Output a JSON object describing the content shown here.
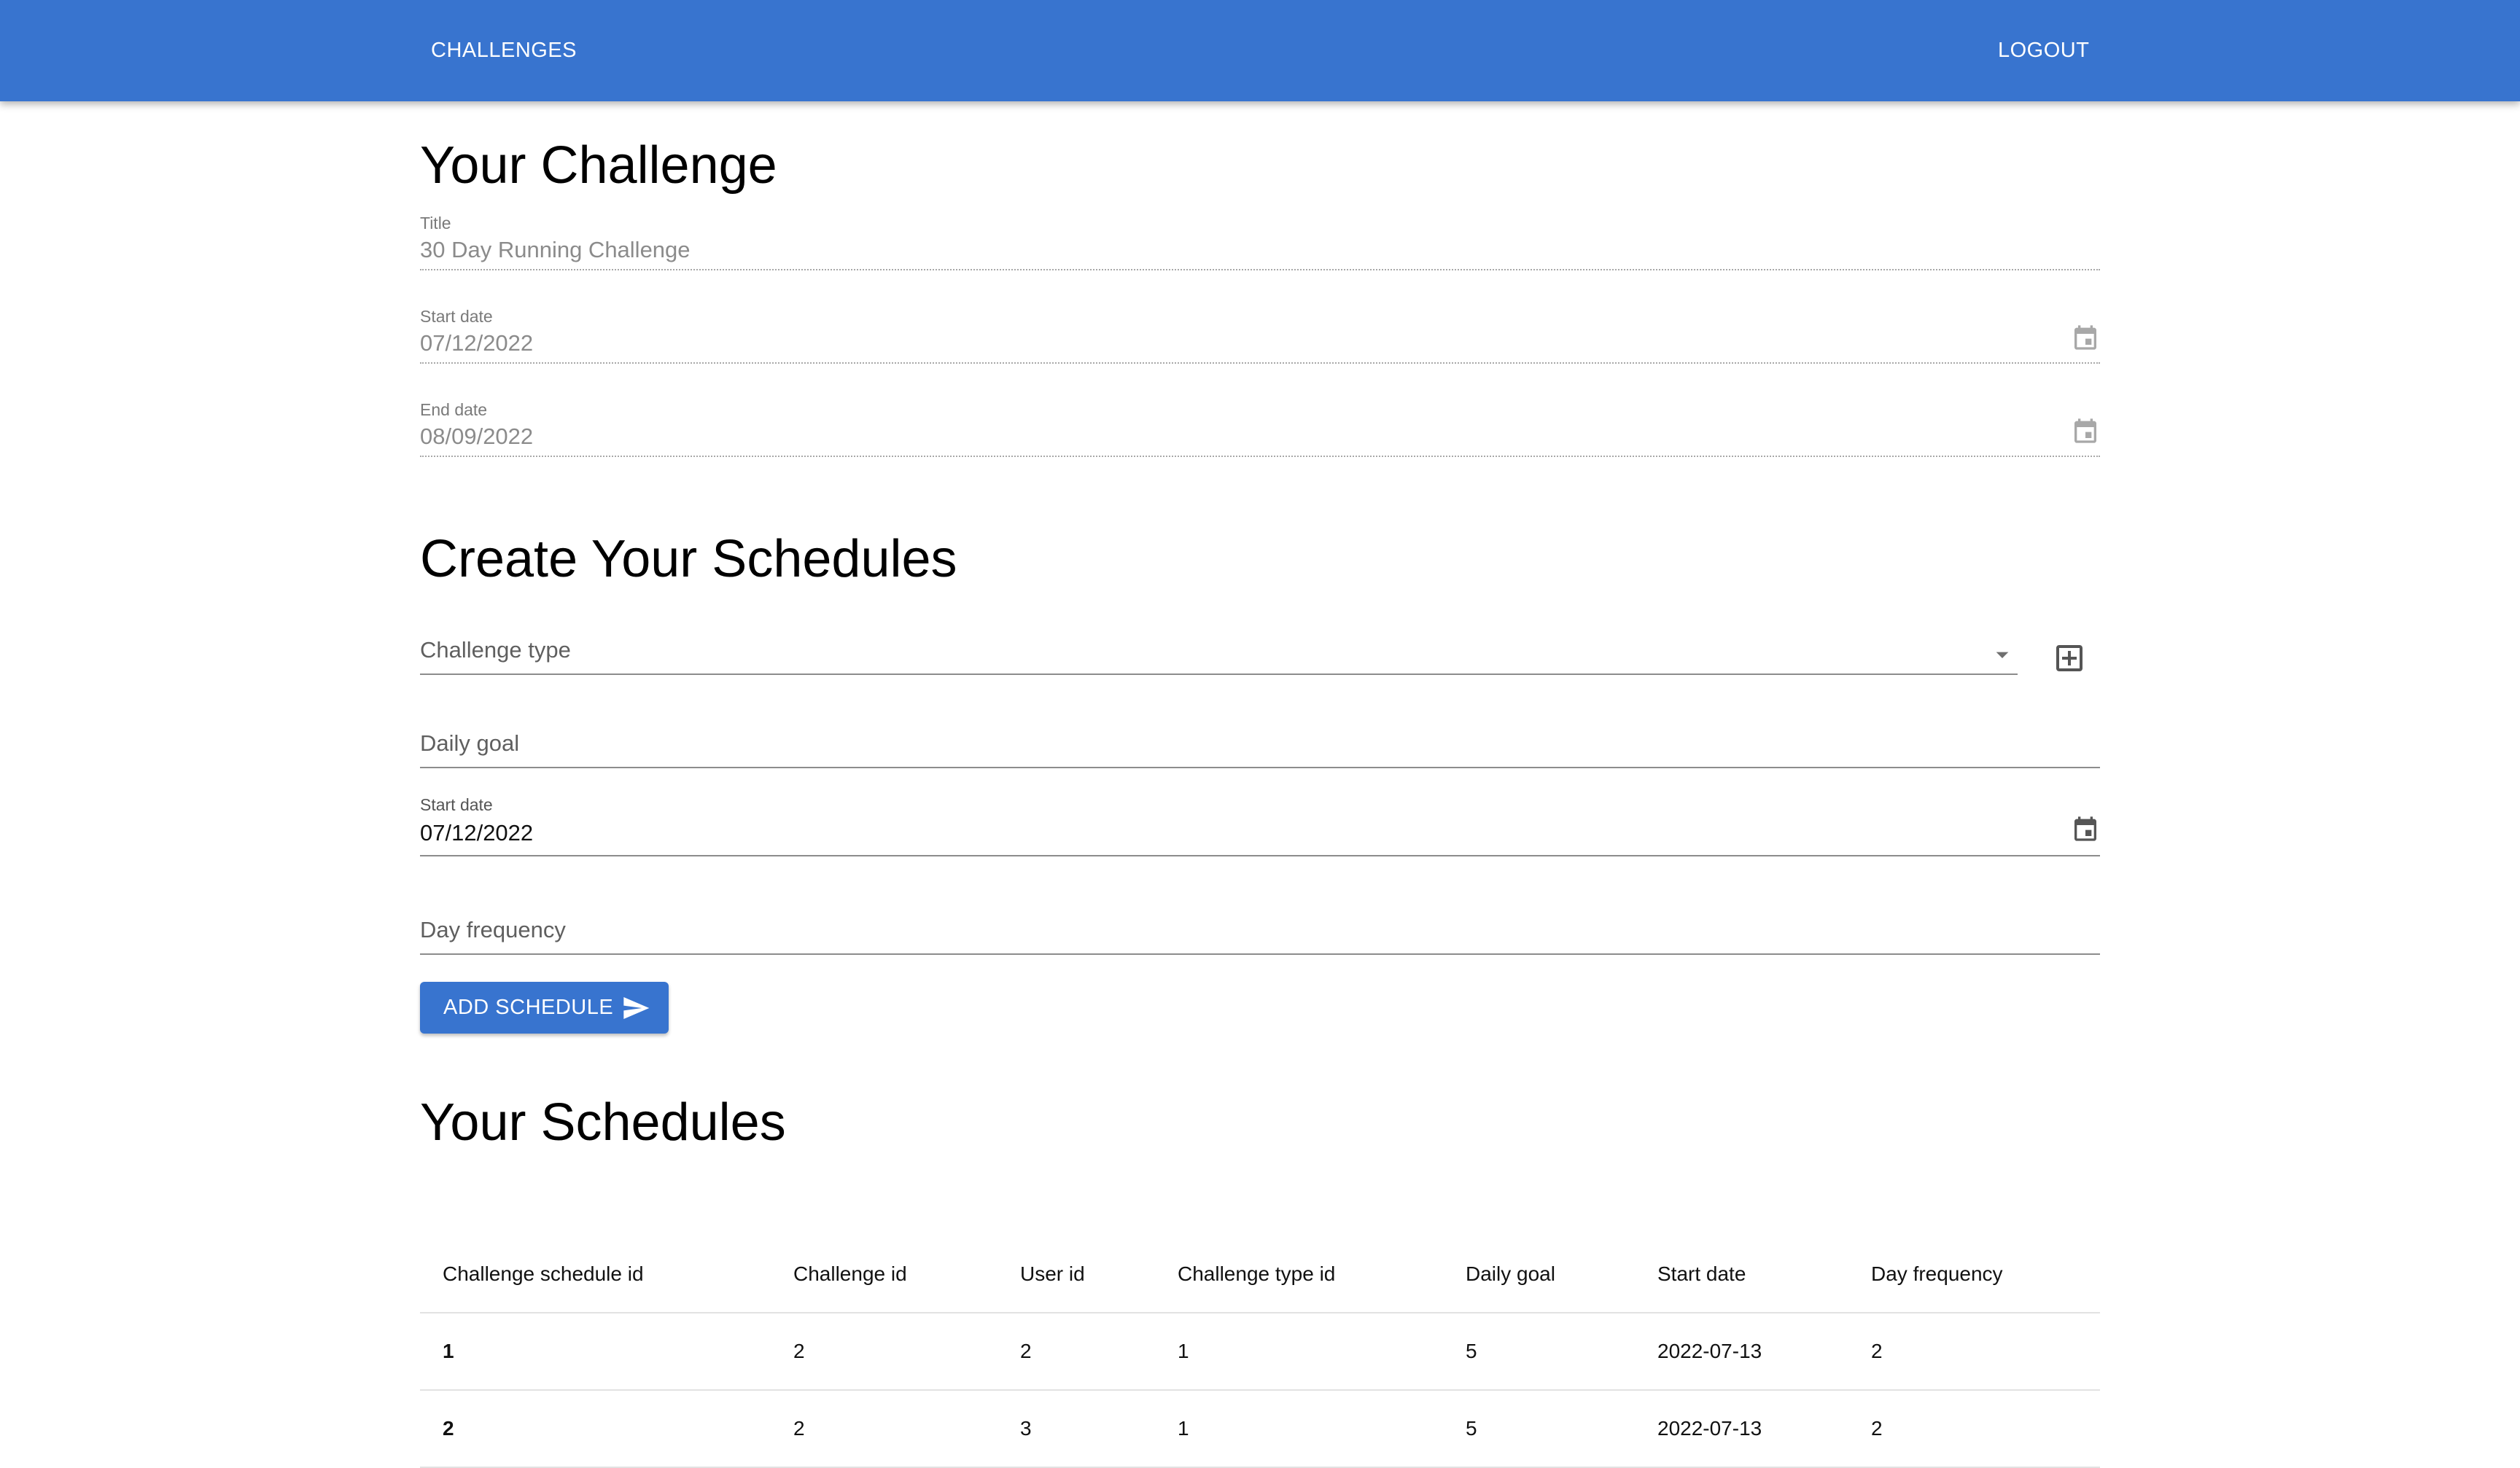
{
  "appbar": {
    "challenges_label": "Challenges",
    "logout_label": "Logout",
    "color": "#3874cf"
  },
  "your_challenge": {
    "heading": "Your Challenge",
    "title_label": "Title",
    "title_value": "30 Day Running Challenge",
    "start_date_label": "Start date",
    "start_date_value": "07/12/2022",
    "end_date_label": "End date",
    "end_date_value": "08/09/2022"
  },
  "create_schedules": {
    "heading": "Create Your Schedules",
    "challenge_type_label": "Challenge type",
    "daily_goal_label": "Daily goal",
    "start_date_label": "Start date",
    "start_date_value": "07/12/2022",
    "day_frequency_label": "Day frequency",
    "add_button_label": "Add Schedule",
    "icons": {
      "dropdown": "chevron-down-icon",
      "add_type": "add-box-icon",
      "calendar": "calendar-icon",
      "send": "send-icon"
    }
  },
  "your_schedules": {
    "heading": "Your Schedules",
    "columns": [
      "Challenge schedule id",
      "Challenge id",
      "User id",
      "Challenge type id",
      "Daily goal",
      "Start date",
      "Day frequency"
    ],
    "rows": [
      [
        "1",
        "2",
        "2",
        "1",
        "5",
        "2022-07-13",
        "2"
      ],
      [
        "2",
        "2",
        "3",
        "1",
        "5",
        "2022-07-13",
        "2"
      ]
    ]
  }
}
